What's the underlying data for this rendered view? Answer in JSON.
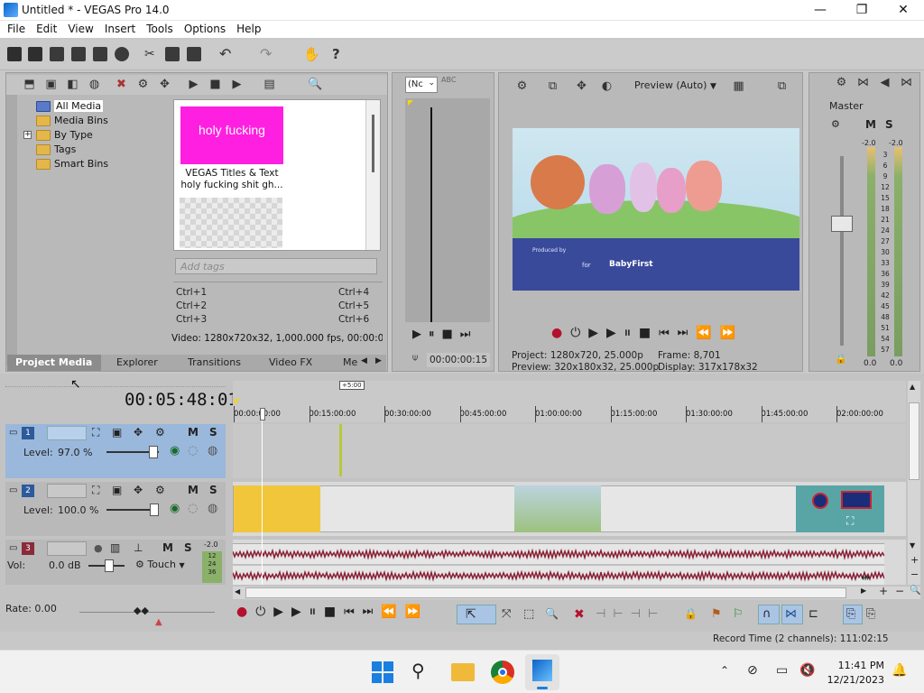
{
  "window": {
    "title": "Untitled * - VEGAS Pro 14.0",
    "minimize": "—",
    "maximize": "❐",
    "close": "✕"
  },
  "menu": [
    "File",
    "Edit",
    "View",
    "Insert",
    "Tools",
    "Options",
    "Help"
  ],
  "project_media": {
    "tree": [
      "All Media",
      "Media Bins",
      "By Type",
      "Tags",
      "Smart Bins"
    ],
    "tree_expander": "+",
    "media_item": {
      "thumb_text": "holy fucking",
      "name1": "VEGAS Titles & Text",
      "name2": "holy fucking shit gh..."
    },
    "tags_placeholder": "Add tags",
    "shortcuts_left": [
      "Ctrl+1",
      "Ctrl+2",
      "Ctrl+3"
    ],
    "shortcuts_right": [
      "Ctrl+4",
      "Ctrl+5",
      "Ctrl+6"
    ],
    "video_info": "Video: 1280x720x32, 1,000.000 fps, 00:00:05:0",
    "tabs": [
      "Project Media",
      "Explorer",
      "Transitions",
      "Video FX",
      "Me"
    ]
  },
  "trimmer": {
    "select_value": "(Nc",
    "timecode": "00:00:00:15",
    "abc_label": "ABC"
  },
  "preview": {
    "mode": "Preview (Auto)",
    "project_label": "Project:",
    "project_value": "1280x720, 25.000p",
    "frame_label": "Frame:",
    "frame_value": "8,701",
    "preview_label": "Preview:",
    "preview_value": "320x180x32, 25.000p",
    "display_label": "Display:",
    "display_value": "317x178x32",
    "image_text1": "Produced by",
    "image_text2": "for",
    "image_text3": "BabyFirst"
  },
  "master": {
    "label": "Master",
    "left_db": "-2.0",
    "right_db": "-2.0",
    "scale": [
      "3",
      "6",
      "9",
      "12",
      "15",
      "18",
      "21",
      "24",
      "27",
      "30",
      "33",
      "36",
      "39",
      "42",
      "45",
      "48",
      "51",
      "54",
      "57"
    ],
    "bottom_left": "0.0",
    "bottom_right": "0.0",
    "m": "M",
    "s": "S"
  },
  "timeline": {
    "position": "00:05:48:01",
    "offset_badge": "+5:00",
    "ruler": [
      "00:00:00:00",
      "00:15:00:00",
      "00:30:00:00",
      "00:45:00:00",
      "01:00:00:00",
      "01:15:00:00",
      "01:30:00:00",
      "01:45:00:00",
      "02:00:00:00"
    ],
    "tracks": [
      {
        "num": "1",
        "level_label": "Level:",
        "level_value": "97.0 %",
        "m": "M",
        "s": "S"
      },
      {
        "num": "2",
        "level_label": "Level:",
        "level_value": "100.0 %",
        "m": "M",
        "s": "S"
      },
      {
        "num": "3",
        "vol_label": "Vol:",
        "vol_value": "0.0 dB",
        "touch": "Touch",
        "m": "M",
        "s": "S",
        "meter_db": "-2.0",
        "meter_scale": [
          "12",
          "24",
          "36"
        ]
      }
    ],
    "rate": "Rate: 0.00",
    "record_time": "Record Time (2 channels): 111:02:15"
  },
  "taskbar": {
    "time": "11:41 PM",
    "date": "12/21/2023"
  }
}
